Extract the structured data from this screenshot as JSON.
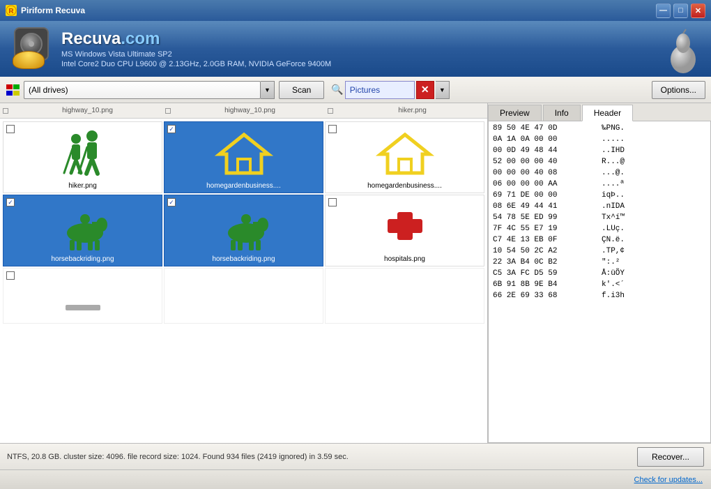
{
  "window": {
    "title": "Piriform Recuva"
  },
  "header": {
    "app_name": "Recuva",
    "app_domain": ".com",
    "system_info_1": "MS Windows Vista Ultimate SP2",
    "system_info_2": "Intel Core2 Duo CPU L9600 @ 2.13GHz, 2.0GB RAM, NVIDIA GeForce 9400M"
  },
  "toolbar": {
    "drive_label": "(All drives)",
    "scan_label": "Scan",
    "filter_value": "Pictures",
    "options_label": "Options..."
  },
  "file_grid": {
    "header_files": [
      "highway_10.png",
      "highway_10.png",
      "hiker.png"
    ],
    "files": [
      {
        "name": "hiker.png",
        "selected": false,
        "checked": false,
        "icon": "hiker"
      },
      {
        "name": "homegardenbusiness....",
        "selected": true,
        "checked": true,
        "icon": "house"
      },
      {
        "name": "homegardenbusiness....",
        "selected": false,
        "checked": false,
        "icon": "house"
      },
      {
        "name": "horsebackriding.png",
        "selected": true,
        "checked": true,
        "icon": "horse"
      },
      {
        "name": "horsebackriding.png",
        "selected": true,
        "checked": true,
        "icon": "horse"
      },
      {
        "name": "hospitals.png",
        "selected": false,
        "checked": false,
        "icon": "cross"
      }
    ]
  },
  "panel": {
    "tabs": [
      "Preview",
      "Info",
      "Header"
    ],
    "active_tab": "Header",
    "hex_data": [
      {
        "bytes": "89 50 4E 47 0D",
        "chars": "‰PNG."
      },
      {
        "bytes": "0A 1A 0A 00 00",
        "chars": "....."
      },
      {
        "bytes": "00 0D 49 48 44",
        "chars": "..IHD"
      },
      {
        "bytes": "52 00 00 00 40",
        "chars": "R...@"
      },
      {
        "bytes": "00 00 00 40 08",
        "chars": "...@."
      },
      {
        "bytes": "06 00 00 00 AA",
        "chars": "....ª"
      },
      {
        "bytes": "69 71 DE 00 00",
        "chars": "iqÞ.."
      },
      {
        "bytes": "08 6E 49 44 41",
        "chars": ".nIDA"
      },
      {
        "bytes": "54 78 5E ED 99",
        "chars": "Tx^í™"
      },
      {
        "bytes": "7F 4C 55 E7 19",
        "chars": ".LUç."
      },
      {
        "bytes": "C7 4E 13 EB 0F",
        "chars": "ÇN.ë."
      },
      {
        "bytes": "10 54 50 2C A2",
        "chars": ".TP,¢"
      },
      {
        "bytes": "22 3A B4 0C B2",
        "chars": "\":.²"
      },
      {
        "bytes": "C5 3A FC D5 59",
        "chars": "Å:üÕY"
      },
      {
        "bytes": "6B 91 8B 9E B4",
        "chars": "k'.<´"
      },
      {
        "bytes": "66 2E 69 33 68",
        "chars": "f.i3h"
      }
    ]
  },
  "status": {
    "text": "NTFS, 20.8 GB. cluster size: 4096. file record size: 1024. Found 934 files (2419 ignored) in 3.59 sec.",
    "recover_label": "Recover..."
  },
  "footer": {
    "check_updates": "Check for updates..."
  },
  "title_bar_buttons": {
    "minimize": "—",
    "maximize": "□",
    "close": "✕"
  }
}
